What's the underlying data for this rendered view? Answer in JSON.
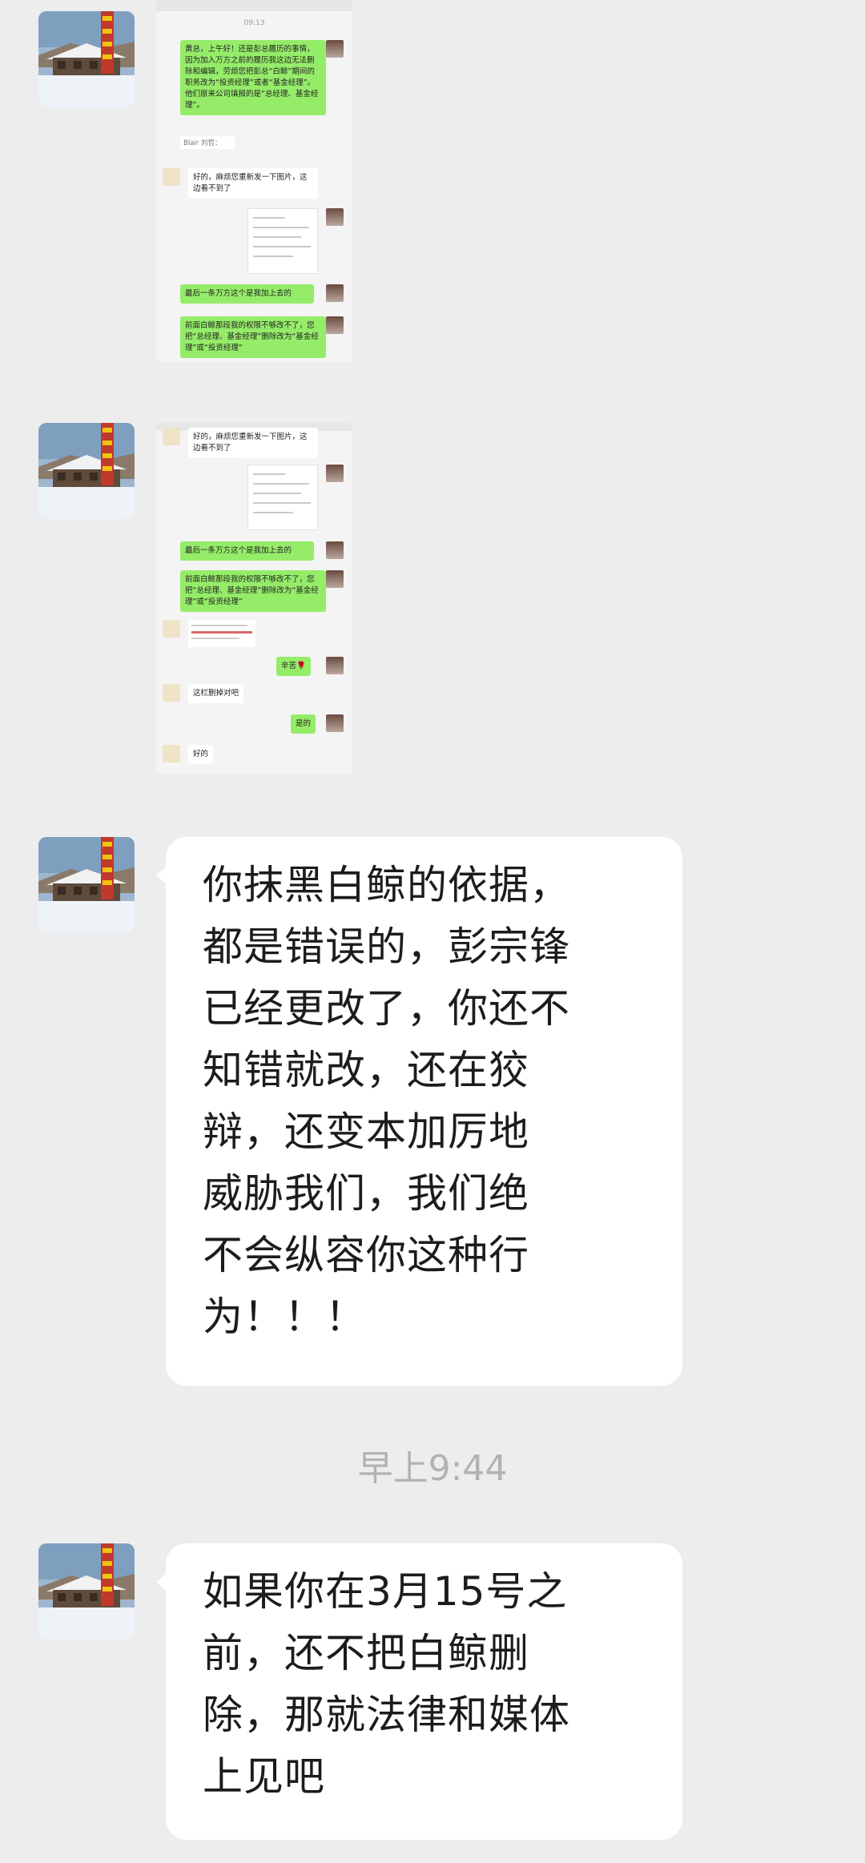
{
  "messages": [
    {
      "type": "image",
      "content": {
        "header_time": "09:13",
        "item1": "黄总，上午好！还是彭总履历的事情，因为加入万方之前的履历我这边无法删除和编辑，劳烦您把彭总“白鲸”期间的职务改为“投资经理”或者“基金经理”。他们原来公司填报的是“总经理、基金经理”。",
        "item2_label": "Blair 刘哲：",
        "item3": "好的，麻烦您重新发一下图片，这边看不到了",
        "item5": "最后一条万方这个是我加上去的",
        "item6": "前面白鲸那段我的权限不够改不了，您把“总经理、基金经理”删除改为“基金经理”或“投资经理”"
      }
    },
    {
      "type": "image",
      "content": {
        "item1": "好的，麻烦您重新发一下图片，这边看不到了",
        "item3": "最后一条万方这个是我加上去的",
        "item4": "前面白鲸那段我的权限不够改不了，您把“总经理、基金经理”删除改为“基金经理”或“投资经理”",
        "item6": "辛苦🌹",
        "item7": "这栏删掉对吧",
        "item8": "是的",
        "item9": "好的"
      }
    },
    {
      "type": "text",
      "lines": [
        "你抹黑白鲸的依据，",
        "都是错误的，彭宗锋",
        "已经更改了，你还不",
        "知错就改，还在狡",
        "辩，还变本加厉地",
        "威胁我们，我们绝",
        "不会纵容你这种行",
        "为！！！"
      ]
    },
    {
      "type": "text",
      "lines": [
        "如果你在3月15号之",
        "前，还不把白鲸删",
        "除，那就法律和媒体",
        "上见吧"
      ]
    }
  ],
  "time_divider": "早上9:44"
}
